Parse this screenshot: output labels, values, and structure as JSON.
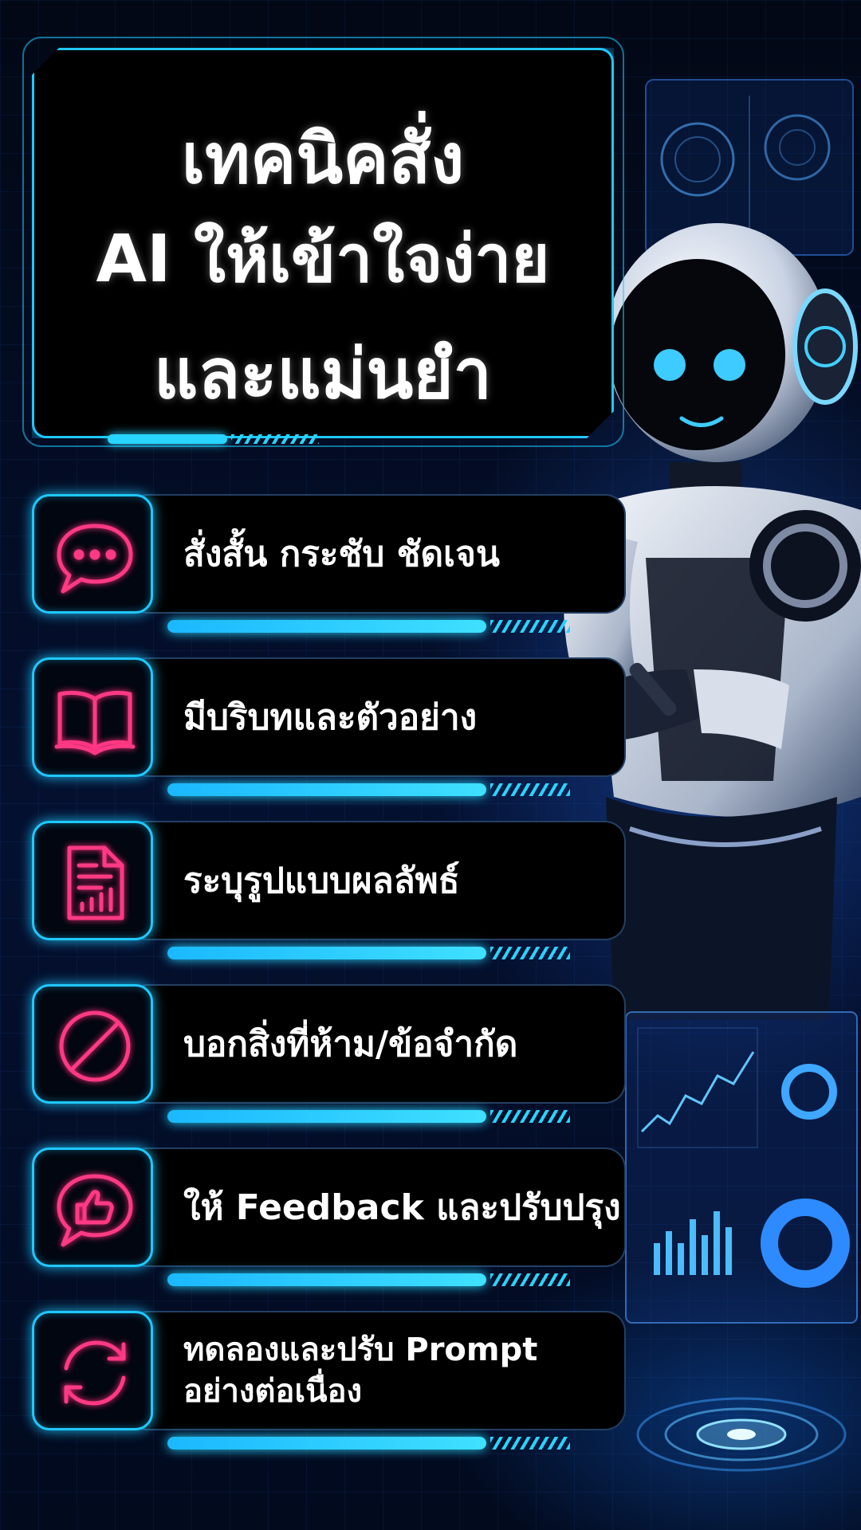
{
  "title": {
    "line1": "เทคนิคสั่ง",
    "line2": "AI ให้เข้าใจง่าย",
    "line3": "และแม่นยำ"
  },
  "items": [
    {
      "text": "สั่งสั้น กระชับ ชัดเจน",
      "icon": "chat-bubble-icon"
    },
    {
      "text": "มีบริบทและตัวอย่าง",
      "icon": "open-book-icon"
    },
    {
      "text": "ระบุรูปแบบผลลัพธ์",
      "icon": "document-chart-icon"
    },
    {
      "text": "บอกสิ่งที่ห้าม/ข้อจำกัด",
      "icon": "prohibited-icon"
    },
    {
      "text": "ให้ Feedback และปรับปรุง",
      "icon": "thumbs-up-icon"
    },
    {
      "text": "ทดลองและปรับ Prompt\nอย่างต่อเนื่อง",
      "icon": "refresh-icon"
    }
  ],
  "colors": {
    "accent_cyan": "#1fc8ff",
    "icon_pink": "#ff3a84",
    "background": "#01050f"
  }
}
